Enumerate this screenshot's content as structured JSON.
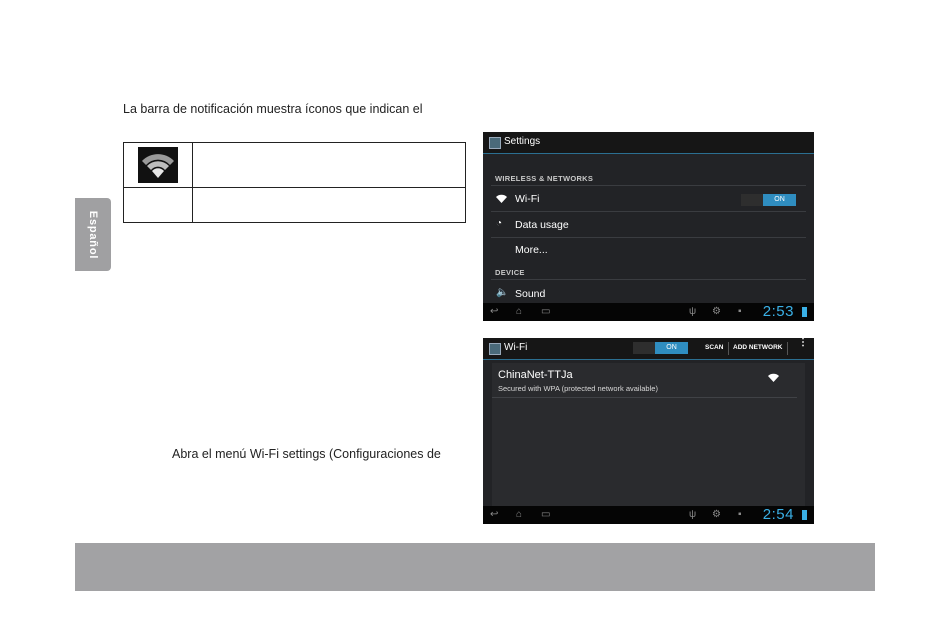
{
  "intro_text": "La barra de notificación muestra íconos que indican el",
  "instruction_text": "Abra el menú Wi-Fi settings (Configuraciones de",
  "side_tab": "Español",
  "icon_table": {
    "rows": [
      {
        "icon": "wifi-icon",
        "text": ""
      },
      {
        "icon": "",
        "text": ""
      }
    ]
  },
  "settings_screen": {
    "title": "Settings",
    "section_wireless": "WIRELESS & NETWORKS",
    "wifi_label": "Wi-Fi",
    "wifi_toggle": "ON",
    "data_usage_label": "Data usage",
    "more_label": "More...",
    "section_device": "DEVICE",
    "sound_label": "Sound",
    "clock": "2:53"
  },
  "wifi_screen": {
    "title": "Wi-Fi",
    "toggle": "ON",
    "scan_label": "SCAN",
    "add_network_label": "ADD NETWORK",
    "network_name": "ChinaNet-TTJa",
    "network_status": "Secured with WPA (protected network available)",
    "clock": "2:54"
  },
  "colors": {
    "accent": "#3ab0e6",
    "toggle_on": "#2f8dc0",
    "gray_bar": "#a2a2a4"
  }
}
